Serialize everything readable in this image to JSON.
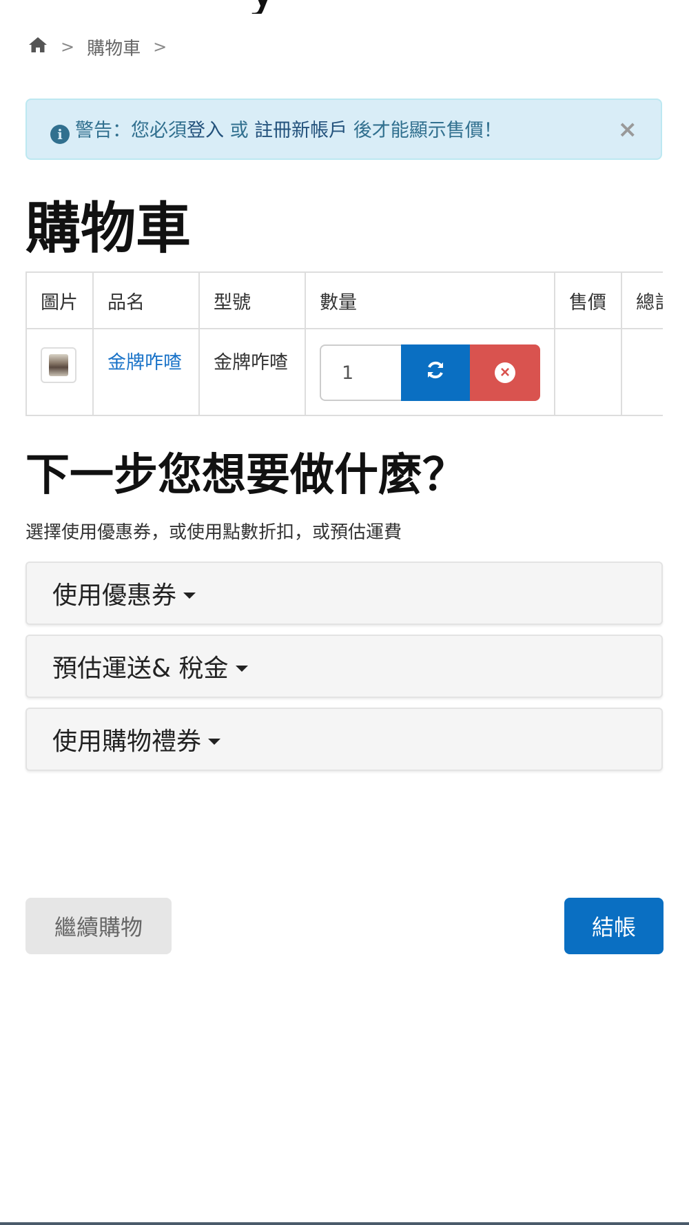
{
  "top_sliver_text": "y",
  "breadcrumb": {
    "home_icon": "home-icon",
    "separator": ">",
    "items": [
      "購物車"
    ]
  },
  "alert": {
    "icon": "info-icon",
    "prefix": "警告：您必須",
    "login_link": "登入",
    "middle": " 或 ",
    "register_link": "註冊新帳戶",
    "suffix": " 後才能顯示售價！",
    "close": "×"
  },
  "page_title": "購物車",
  "cart_table": {
    "headers": [
      "圖片",
      "品名",
      "型號",
      "數量",
      "售價",
      "總計"
    ],
    "rows": [
      {
        "image_icon": "product-thumbnail",
        "name": "金牌咋喳",
        "model": "金牌咋喳",
        "quantity": "1",
        "price": "",
        "total": ""
      }
    ]
  },
  "next_steps": {
    "title": "下一步您想要做什麼？",
    "subtitle": "選擇使用優惠券，或使用點數折扣，或預估運費",
    "panels": [
      {
        "label": "使用優惠券"
      },
      {
        "label": "預估運送& 稅金"
      },
      {
        "label": "使用購物禮券"
      }
    ]
  },
  "buttons": {
    "continue": "繼續購物",
    "checkout": "結帳"
  },
  "colors": {
    "primary": "#0a6fc2",
    "danger": "#d9534f",
    "alert_bg": "#d9edf7",
    "link": "#1a73c8"
  }
}
